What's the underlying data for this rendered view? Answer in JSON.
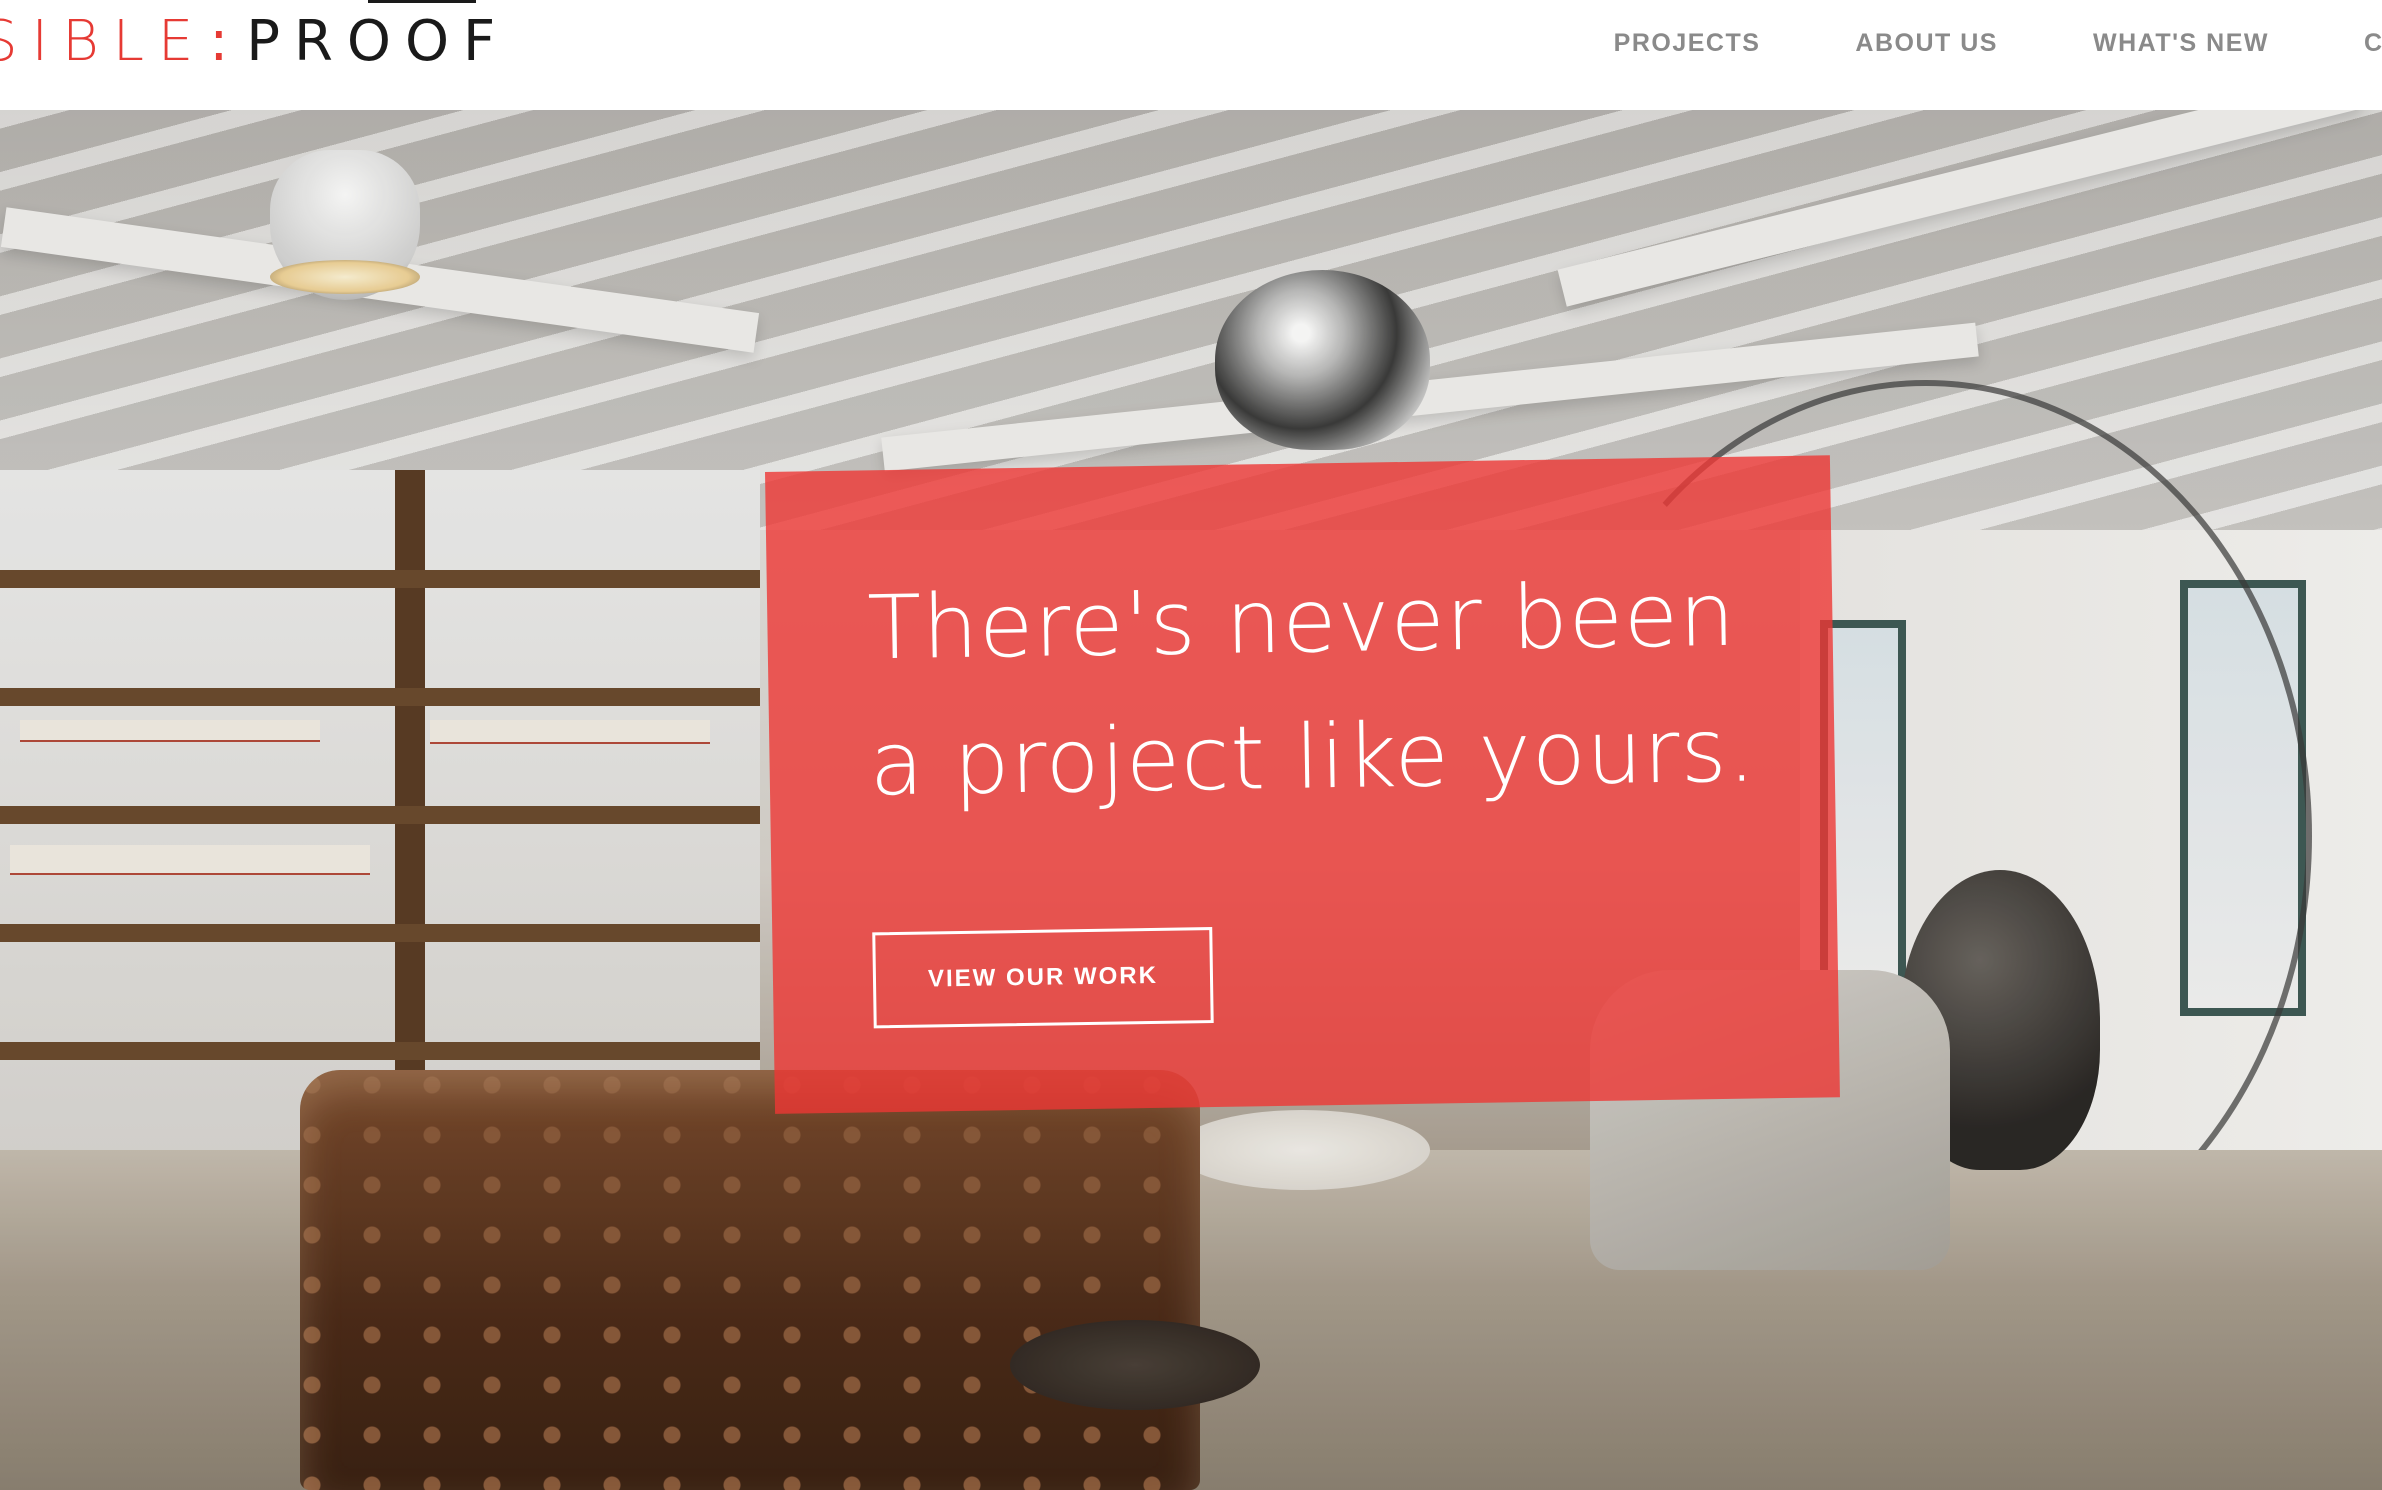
{
  "header": {
    "logo": {
      "left_text": "SIBLE",
      "colon": ":",
      "right_text": "PROOF"
    },
    "nav": [
      {
        "label": "PROJECTS"
      },
      {
        "label": "ABOUT US"
      },
      {
        "label": "WHAT'S NEW"
      },
      {
        "label": "C"
      }
    ]
  },
  "hero": {
    "headline": "There's never been a project like yours.",
    "cta_label": "VIEW OUR WORK",
    "card_color": "#ee3734"
  },
  "colors": {
    "brand_red": "#e63a34",
    "nav_text": "#8a8a8a",
    "logo_dark": "#1a1a1a"
  }
}
